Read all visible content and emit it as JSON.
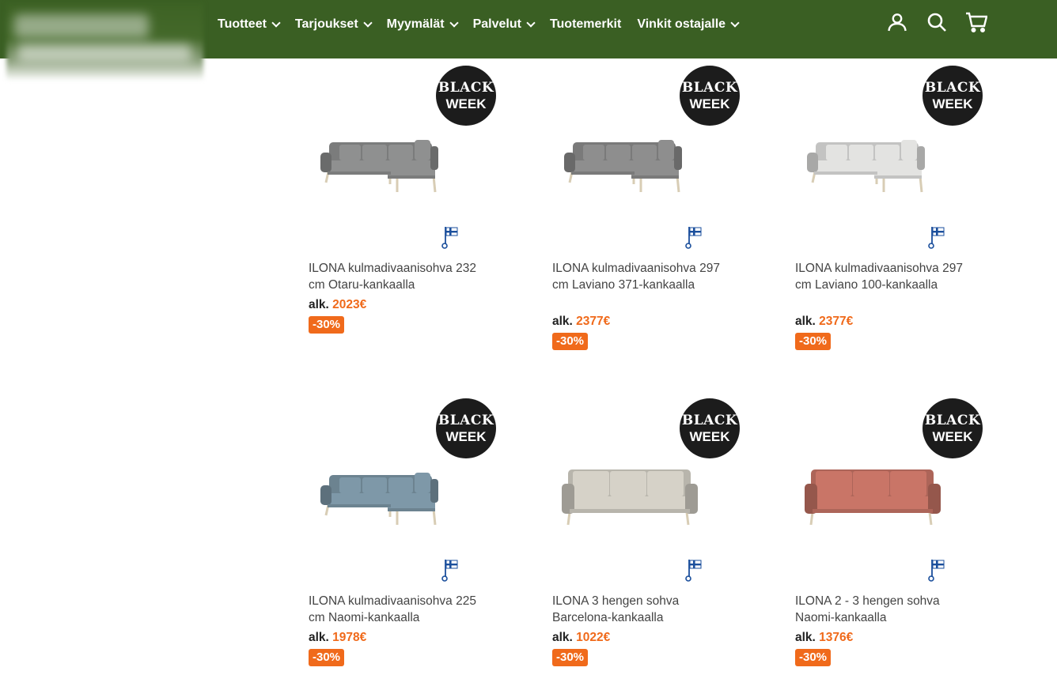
{
  "nav": {
    "items": [
      {
        "label": "Tuotteet",
        "dropdown": true
      },
      {
        "label": "Tarjoukset",
        "dropdown": true
      },
      {
        "label": "Myymälät",
        "dropdown": true
      },
      {
        "label": "Palvelut",
        "dropdown": true
      },
      {
        "label": "Tuotemerkit",
        "dropdown": false
      },
      {
        "label": "Vinkit ostajalle",
        "dropdown": true
      }
    ],
    "icons": [
      "user-icon",
      "search-icon",
      "cart-icon"
    ]
  },
  "colors": {
    "header_bg": "#3a5f23",
    "price": "#f06a1b",
    "badge_bg": "#1c1c1c"
  },
  "badge": {
    "line1": "BLACK",
    "line2": "WEEK"
  },
  "products": [
    {
      "title": "ILONA kulmadivaanisohva 232 cm Otaru-kankaalla",
      "alk": "alk.",
      "price": "2023€",
      "discount": "-30%",
      "fabric": "#8f9090",
      "shape": "corner"
    },
    {
      "title": "ILONA kulmadivaanisohva 297 cm Laviano 371-kankaalla",
      "alk": "alk.",
      "price": "2377€",
      "discount": "-30%",
      "fabric": "#8e8e8e",
      "shape": "corner"
    },
    {
      "title": "ILONA kulmadivaanisohva 297 cm Laviano 100-kankaalla",
      "alk": "alk.",
      "price": "2377€",
      "discount": "-30%",
      "fabric": "#e3e3e1",
      "shape": "corner"
    },
    {
      "title": "ILONA kulmadivaanisohva 225 cm Naomi-kankaalla",
      "alk": "alk.",
      "price": "1978€",
      "discount": "-30%",
      "fabric": "#7e98a8",
      "shape": "corner"
    },
    {
      "title": "ILONA 3 hengen sohva Barcelona-kankaalla",
      "alk": "alk.",
      "price": "1022€",
      "discount": "-30%",
      "fabric": "#d6d2c8",
      "shape": "straight"
    },
    {
      "title": "ILONA 2 - 3 hengen sohva Naomi-kankaalla",
      "alk": "alk.",
      "price": "1376€",
      "discount": "-30%",
      "fabric": "#c97567",
      "shape": "straight"
    }
  ]
}
